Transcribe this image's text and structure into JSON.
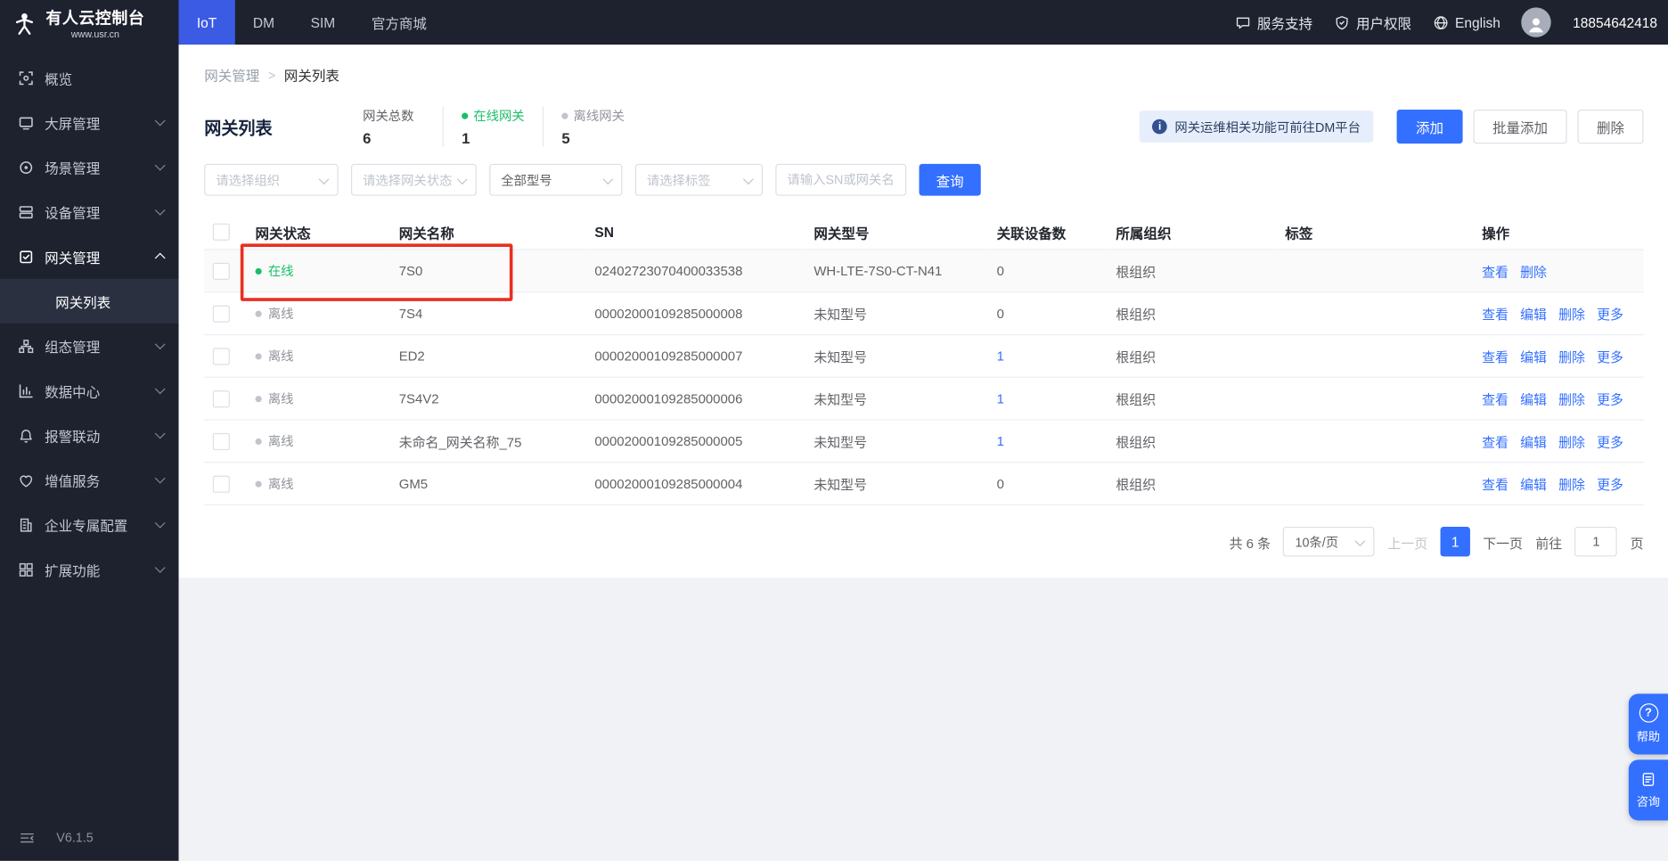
{
  "brand": {
    "title": "有人云控制台",
    "subtitle": "www.usr.cn",
    "version": "V6.1.5"
  },
  "topnav": {
    "tabs": [
      {
        "key": "iot",
        "label": "IoT",
        "active": true
      },
      {
        "key": "dm",
        "label": "DM",
        "active": false
      },
      {
        "key": "sim",
        "label": "SIM",
        "active": false
      },
      {
        "key": "mall",
        "label": "官方商城",
        "active": false
      }
    ],
    "service_support": "服务支持",
    "user_permissions": "用户权限",
    "language": "English",
    "account": "18854642418"
  },
  "sidebar": {
    "items": [
      {
        "key": "overview",
        "label": "概览",
        "icon": "overview-icon",
        "expandable": false
      },
      {
        "key": "screen-management",
        "label": "大屏管理",
        "icon": "screen-icon",
        "expandable": true
      },
      {
        "key": "scene-management",
        "label": "场景管理",
        "icon": "scene-icon",
        "expandable": true
      },
      {
        "key": "device-management",
        "label": "设备管理",
        "icon": "device-icon",
        "expandable": true
      },
      {
        "key": "gateway-management",
        "label": "网关管理",
        "icon": "gateway-icon",
        "expandable": true,
        "expanded": true,
        "active": true,
        "children": [
          {
            "key": "gateway-list",
            "label": "网关列表",
            "active": true
          }
        ]
      },
      {
        "key": "configuration-management",
        "label": "组态管理",
        "icon": "configuration-icon",
        "expandable": true
      },
      {
        "key": "data-center",
        "label": "数据中心",
        "icon": "data-center-icon",
        "expandable": true
      },
      {
        "key": "alarm-linkage",
        "label": "报警联动",
        "icon": "alarm-icon",
        "expandable": true
      },
      {
        "key": "value-added-services",
        "label": "增值服务",
        "icon": "value-added-icon",
        "expandable": true
      },
      {
        "key": "enterprise-config",
        "label": "企业专属配置",
        "icon": "enterprise-icon",
        "expandable": true
      },
      {
        "key": "extended-functions",
        "label": "扩展功能",
        "icon": "extension-icon",
        "expandable": true
      }
    ]
  },
  "breadcrumb": {
    "parent": "网关管理",
    "separator": ">",
    "current": "网关列表"
  },
  "page": {
    "title": "网关列表",
    "stats": [
      {
        "key": "total",
        "label": "网关总数",
        "value": "6",
        "dot": null
      },
      {
        "key": "online",
        "label": "在线网关",
        "value": "1",
        "dot": "online"
      },
      {
        "key": "offline",
        "label": "离线网关",
        "value": "5",
        "dot": "offline"
      }
    ],
    "notice": "网关运维相关功能可前往DM平台",
    "buttons": {
      "add": "添加",
      "batch_add": "批量添加",
      "delete": "删除"
    }
  },
  "filters": {
    "org_placeholder": "请选择组织",
    "status_placeholder": "请选择网关状态",
    "model_value": "全部型号",
    "tag_placeholder": "请选择标签",
    "sn_placeholder": "请输入SN或网关名称",
    "search_label": "查询"
  },
  "table": {
    "headers": [
      "网关状态",
      "网关名称",
      "SN",
      "网关型号",
      "关联设备数",
      "所属组织",
      "标签",
      "操作"
    ],
    "rows": [
      {
        "status": "在线",
        "online": true,
        "name": "7S0",
        "sn": "02402723070400033538",
        "model": "WH-LTE-7S0-CT-N41",
        "devices": "0",
        "devices_link": false,
        "org": "根组织",
        "tag": "",
        "highlighted": true,
        "actions": [
          {
            "key": "view",
            "label": "查看"
          },
          {
            "key": "delete",
            "label": "删除"
          }
        ]
      },
      {
        "status": "离线",
        "online": false,
        "name": "7S4",
        "sn": "00002000109285000008",
        "model": "未知型号",
        "devices": "0",
        "devices_link": false,
        "org": "根组织",
        "tag": "",
        "highlighted": false,
        "actions": [
          {
            "key": "view",
            "label": "查看"
          },
          {
            "key": "edit",
            "label": "编辑"
          },
          {
            "key": "delete",
            "label": "删除"
          },
          {
            "key": "more",
            "label": "更多"
          }
        ]
      },
      {
        "status": "离线",
        "online": false,
        "name": "ED2",
        "sn": "00002000109285000007",
        "model": "未知型号",
        "devices": "1",
        "devices_link": true,
        "org": "根组织",
        "tag": "",
        "highlighted": false,
        "actions": [
          {
            "key": "view",
            "label": "查看"
          },
          {
            "key": "edit",
            "label": "编辑"
          },
          {
            "key": "delete",
            "label": "删除"
          },
          {
            "key": "more",
            "label": "更多"
          }
        ]
      },
      {
        "status": "离线",
        "online": false,
        "name": "7S4V2",
        "sn": "00002000109285000006",
        "model": "未知型号",
        "devices": "1",
        "devices_link": true,
        "org": "根组织",
        "tag": "",
        "highlighted": false,
        "actions": [
          {
            "key": "view",
            "label": "查看"
          },
          {
            "key": "edit",
            "label": "编辑"
          },
          {
            "key": "delete",
            "label": "删除"
          },
          {
            "key": "more",
            "label": "更多"
          }
        ]
      },
      {
        "status": "离线",
        "online": false,
        "name": "未命名_网关名称_75",
        "sn": "00002000109285000005",
        "model": "未知型号",
        "devices": "1",
        "devices_link": true,
        "org": "根组织",
        "tag": "",
        "highlighted": false,
        "actions": [
          {
            "key": "view",
            "label": "查看"
          },
          {
            "key": "edit",
            "label": "编辑"
          },
          {
            "key": "delete",
            "label": "删除"
          },
          {
            "key": "more",
            "label": "更多"
          }
        ]
      },
      {
        "status": "离线",
        "online": false,
        "name": "GM5",
        "sn": "00002000109285000004",
        "model": "未知型号",
        "devices": "0",
        "devices_link": false,
        "org": "根组织",
        "tag": "",
        "highlighted": false,
        "actions": [
          {
            "key": "view",
            "label": "查看"
          },
          {
            "key": "edit",
            "label": "编辑"
          },
          {
            "key": "delete",
            "label": "删除"
          },
          {
            "key": "more",
            "label": "更多"
          }
        ]
      }
    ]
  },
  "pagination": {
    "total": "共 6 条",
    "page_size": "10条/页",
    "prev": "上一页",
    "current": "1",
    "next": "下一页",
    "goto_label": "前往",
    "goto_value": "1",
    "page_unit": "页"
  },
  "floating": {
    "help": "帮助",
    "consult": "咨询"
  },
  "colors": {
    "primary": "#3370ff",
    "online": "#19be6b",
    "offline": "#909399",
    "highlight_box": "#e82f21"
  }
}
